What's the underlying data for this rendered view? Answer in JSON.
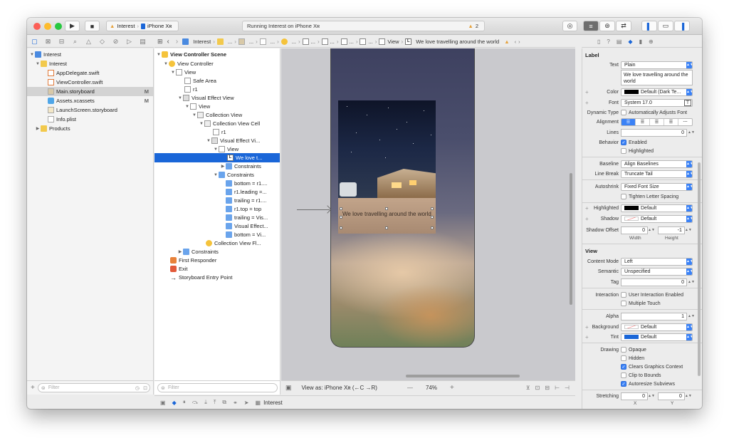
{
  "toolbar": {
    "scheme_name": "Interest",
    "device": "iPhone Xʀ",
    "activity_text": "Running Interest on iPhone Xʀ",
    "warning_count": "2"
  },
  "navigator": {
    "items": [
      {
        "label": "Interest",
        "badge": ""
      },
      {
        "label": "Interest",
        "badge": ""
      },
      {
        "label": "AppDelegate.swift",
        "badge": ""
      },
      {
        "label": "ViewController.swift",
        "badge": ""
      },
      {
        "label": "Main.storyboard",
        "badge": "M"
      },
      {
        "label": "Assets.xcassets",
        "badge": "M"
      },
      {
        "label": "LaunchScreen.storyboard",
        "badge": ""
      },
      {
        "label": "Info.plist",
        "badge": ""
      },
      {
        "label": "Products",
        "badge": ""
      }
    ],
    "filter_placeholder": "Filter"
  },
  "jumpbar": {
    "project": "Interest",
    "ellipsis": "...",
    "view": "View",
    "label_badge": "L",
    "current": "We love travelling around the world"
  },
  "outline": {
    "items": [
      {
        "label": "View Controller Scene"
      },
      {
        "label": "View Controller"
      },
      {
        "label": "View"
      },
      {
        "label": "Safe Area"
      },
      {
        "label": "r1"
      },
      {
        "label": "Visual Effect View"
      },
      {
        "label": "View"
      },
      {
        "label": "Collection View"
      },
      {
        "label": "Collection View Cell"
      },
      {
        "label": "r1"
      },
      {
        "label": "Visual Effect Vi..."
      },
      {
        "label": "View"
      },
      {
        "label": "We love t..."
      },
      {
        "label": "Constraints"
      },
      {
        "label": "Constraints"
      },
      {
        "label": "bottom = r1...."
      },
      {
        "label": "r1.leading =..."
      },
      {
        "label": "trailing = r1...."
      },
      {
        "label": "r1.top = top"
      },
      {
        "label": "trailing = Vis..."
      },
      {
        "label": "Visual Effect..."
      },
      {
        "label": "bottom = Vi..."
      },
      {
        "label": "Collection View Fl..."
      },
      {
        "label": "Constraints"
      },
      {
        "label": "First Responder"
      },
      {
        "label": "Exit"
      },
      {
        "label": "Storyboard Entry Point"
      }
    ],
    "filter_placeholder": "Filter"
  },
  "canvas": {
    "caption": "We love travelling around the world",
    "view_as": "View as: iPhone Xʀ (←C →R)",
    "zoom": "74%",
    "zoom_minus": "—",
    "zoom_plus": "+"
  },
  "debug": {
    "target": "Interest"
  },
  "inspector": {
    "label_section": "Label",
    "text_label": "Text",
    "text_value": "Plain",
    "text_content": "We love travelling around the world",
    "color_label": "Color",
    "color_value": "Default (Dark Te...",
    "font_label": "Font",
    "font_value": "System 17.0",
    "dynamic_label": "Dynamic Type",
    "dynamic_value": "Automatically Adjusts Font",
    "alignment_label": "Alignment",
    "alignment_last": "---",
    "lines_label": "Lines",
    "lines_value": "0",
    "behavior_label": "Behavior",
    "enabled": "Enabled",
    "highlighted": "Highlighted",
    "baseline_label": "Baseline",
    "baseline_value": "Align Baselines",
    "linebreak_label": "Line Break",
    "linebreak_value": "Truncate Tail",
    "autoshrink_label": "Autoshrink",
    "autoshrink_value": "Fixed Font Size",
    "tighten": "Tighten Letter Spacing",
    "highlighted_label": "Highlighted",
    "highlighted_value": "Default",
    "shadow_label": "Shadow",
    "shadow_value": "Default",
    "shadow_offset_label": "Shadow Offset",
    "shadow_w": "0",
    "shadow_h": "-1",
    "width_label": "Width",
    "height_label": "Height",
    "view_section": "View",
    "content_mode_label": "Content Mode",
    "content_mode_value": "Left",
    "semantic_label": "Semantic",
    "semantic_value": "Unspecified",
    "tag_label": "Tag",
    "tag_value": "0",
    "interaction_label": "Interaction",
    "user_interaction": "User Interaction Enabled",
    "multiple_touch": "Multiple Touch",
    "alpha_label": "Alpha",
    "alpha_value": "1",
    "background_label": "Background",
    "background_value": "Default",
    "tint_label": "Tint",
    "tint_value": "Default",
    "drawing_label": "Drawing",
    "opaque": "Opaque",
    "hidden": "Hidden",
    "clears": "Clears Graphics Context",
    "clip": "Clip to Bounds",
    "autoresize": "Autoresize Subviews",
    "stretching_label": "Stretching",
    "stretch_x": "0",
    "stretch_y": "0",
    "x_label": "X",
    "y_label": "Y"
  },
  "colors": {
    "accent": "#1a66d8",
    "close": "#fc5f57",
    "minimize": "#fdbc2e",
    "zoom": "#28c840"
  }
}
